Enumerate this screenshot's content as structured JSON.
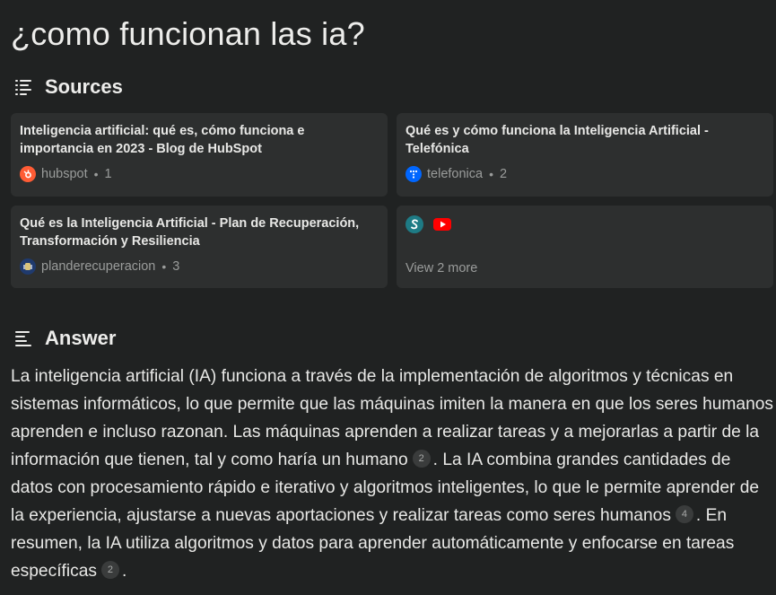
{
  "question": "¿como funcionan las ia?",
  "sources_section": {
    "title": "Sources",
    "cards": [
      {
        "title": "Inteligencia artificial: qué es, cómo funciona e importancia en 2023 - Blog de HubSpot",
        "domain": "hubspot",
        "number": "1"
      },
      {
        "title": "Qué es y cómo funciona la Inteligencia Artificial - Telefónica",
        "domain": "telefonica",
        "number": "2"
      },
      {
        "title": "Qué es la Inteligencia Artificial - Plan de Recuperación, Transformación y Resiliencia",
        "domain": "planderecuperacion",
        "number": "3"
      }
    ],
    "more": {
      "label": "View 2 more"
    }
  },
  "answer_section": {
    "title": "Answer",
    "segments": [
      "La inteligencia artificial (IA) funciona a través de la implementación de algoritmos y técnicas en sistemas informáticos, lo que permite que las máquinas imiten la manera en que los seres humanos aprenden e incluso razonan. Las máquinas aprenden a realizar tareas y a mejorarlas a partir de la información que tienen, tal y como haría un humano",
      ". La IA combina grandes cantidades de datos con procesamiento rápido e iterativo y algoritmos inteligentes, lo que le permite aprender de la experiencia, ajustarse a nuevas aportaciones y realizar tareas como seres humanos",
      ". En resumen, la IA utiliza algoritmos y datos para aprender automáticamente y enfocarse en tareas específicas",
      "."
    ],
    "citations": [
      "2",
      "4",
      "2"
    ]
  },
  "colors": {
    "background": "#202222",
    "card": "#2d2f2f",
    "hubspot": "#ff5c35",
    "telefonica": "#0066ff",
    "youtube": "#ff0000",
    "scribd": "#1e7b85"
  }
}
